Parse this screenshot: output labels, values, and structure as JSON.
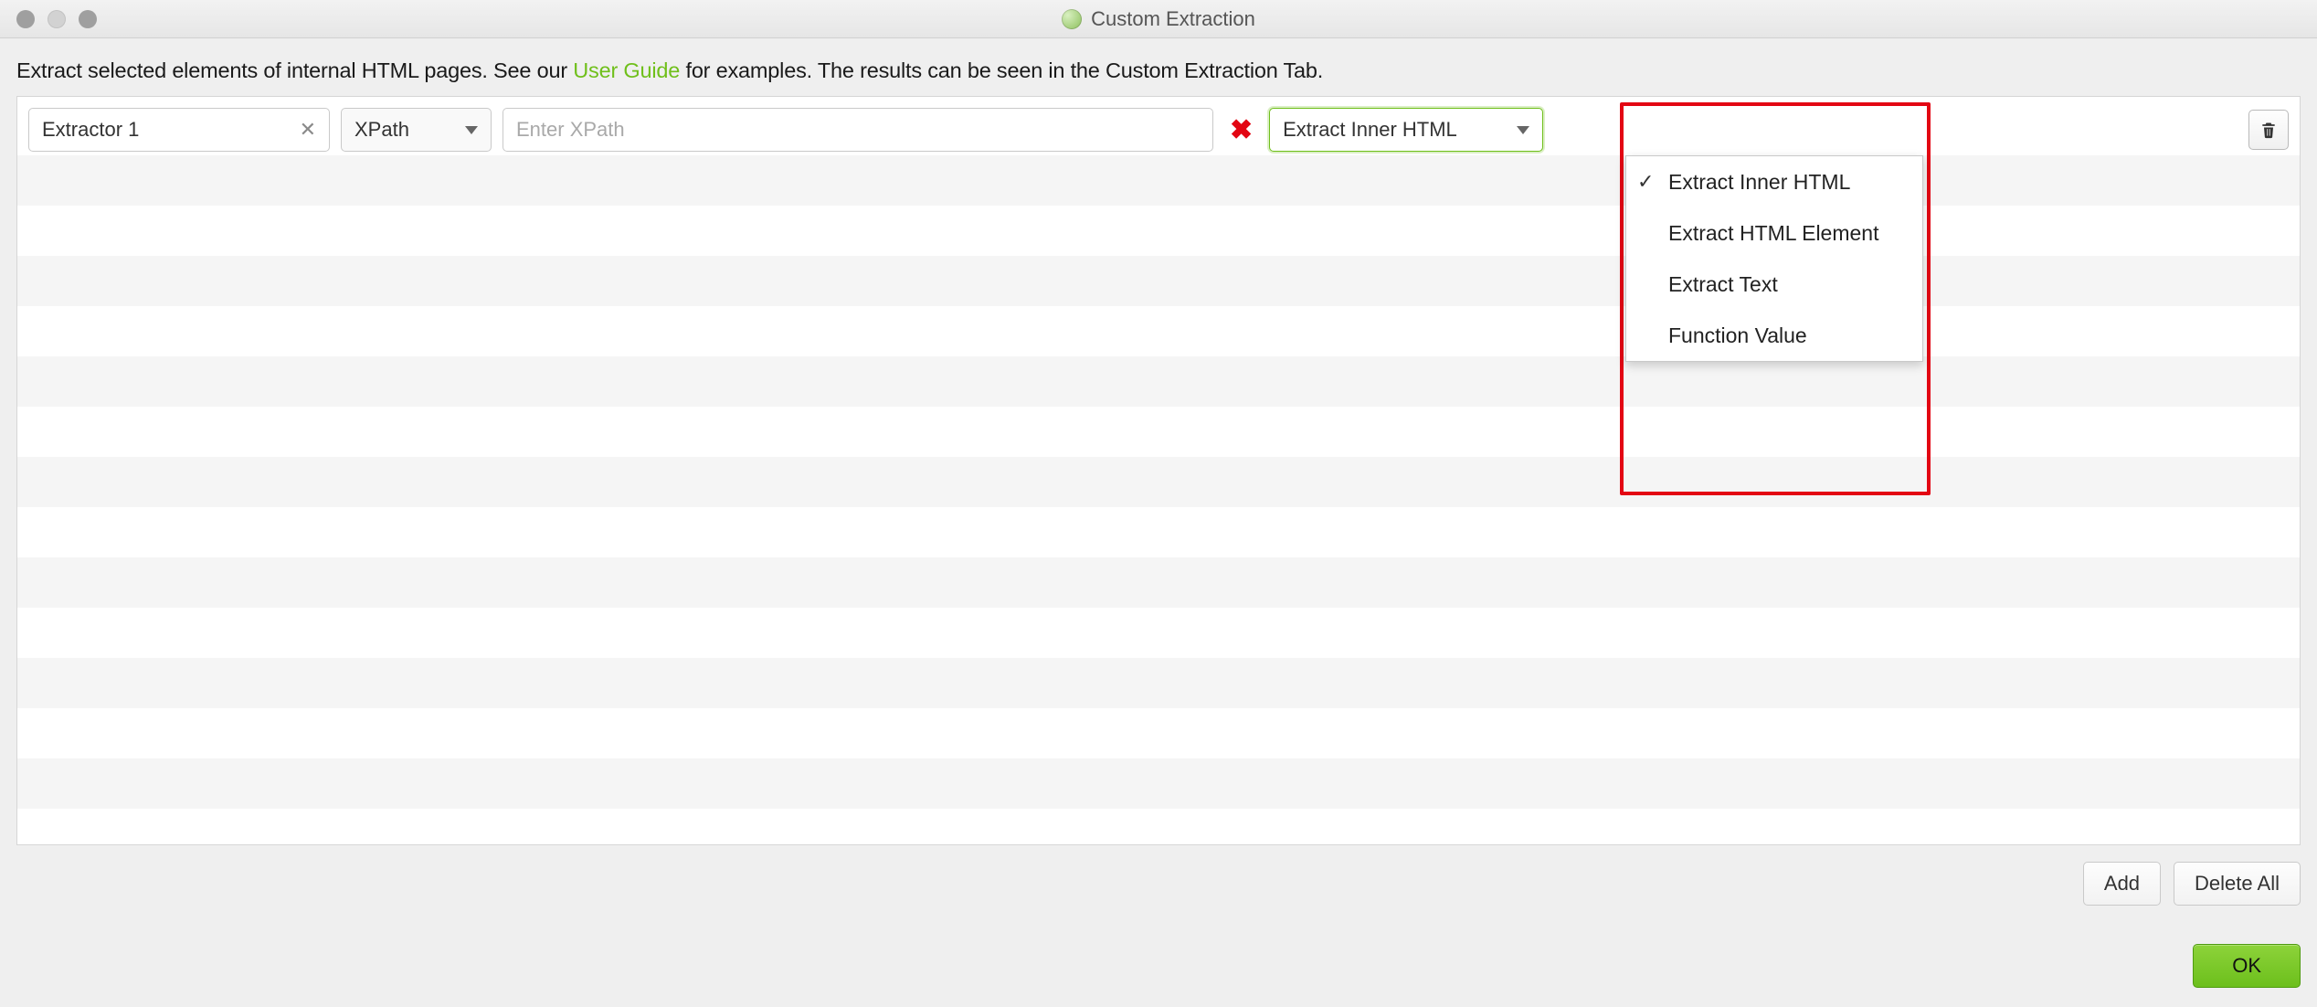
{
  "window": {
    "title": "Custom Extraction"
  },
  "intro": {
    "prefix": "Extract selected elements of internal HTML pages. See our ",
    "link": "User Guide",
    "suffix": " for examples. The results can be seen in the Custom Extraction Tab."
  },
  "row": {
    "name_value": "Extractor 1",
    "method_value": "XPath",
    "xpath_placeholder": "Enter XPath",
    "extract_value": "Extract Inner HTML"
  },
  "dropdown": {
    "items": [
      {
        "label": "Extract Inner HTML",
        "selected": true
      },
      {
        "label": "Extract HTML Element",
        "selected": false
      },
      {
        "label": "Extract Text",
        "selected": false
      },
      {
        "label": "Function Value",
        "selected": false
      }
    ]
  },
  "footer": {
    "add": "Add",
    "delete_all": "Delete All",
    "ok": "OK"
  }
}
